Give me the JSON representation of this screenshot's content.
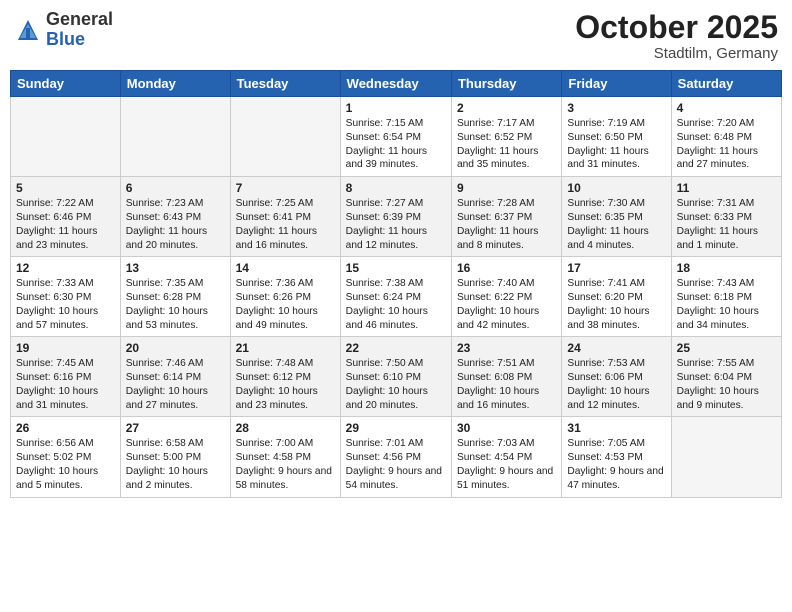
{
  "header": {
    "logo_general": "General",
    "logo_blue": "Blue",
    "month_year": "October 2025",
    "location": "Stadtilm, Germany"
  },
  "days_of_week": [
    "Sunday",
    "Monday",
    "Tuesday",
    "Wednesday",
    "Thursday",
    "Friday",
    "Saturday"
  ],
  "weeks": [
    [
      {
        "day": "",
        "info": ""
      },
      {
        "day": "",
        "info": ""
      },
      {
        "day": "",
        "info": ""
      },
      {
        "day": "1",
        "info": "Sunrise: 7:15 AM\nSunset: 6:54 PM\nDaylight: 11 hours and 39 minutes."
      },
      {
        "day": "2",
        "info": "Sunrise: 7:17 AM\nSunset: 6:52 PM\nDaylight: 11 hours and 35 minutes."
      },
      {
        "day": "3",
        "info": "Sunrise: 7:19 AM\nSunset: 6:50 PM\nDaylight: 11 hours and 31 minutes."
      },
      {
        "day": "4",
        "info": "Sunrise: 7:20 AM\nSunset: 6:48 PM\nDaylight: 11 hours and 27 minutes."
      }
    ],
    [
      {
        "day": "5",
        "info": "Sunrise: 7:22 AM\nSunset: 6:46 PM\nDaylight: 11 hours and 23 minutes."
      },
      {
        "day": "6",
        "info": "Sunrise: 7:23 AM\nSunset: 6:43 PM\nDaylight: 11 hours and 20 minutes."
      },
      {
        "day": "7",
        "info": "Sunrise: 7:25 AM\nSunset: 6:41 PM\nDaylight: 11 hours and 16 minutes."
      },
      {
        "day": "8",
        "info": "Sunrise: 7:27 AM\nSunset: 6:39 PM\nDaylight: 11 hours and 12 minutes."
      },
      {
        "day": "9",
        "info": "Sunrise: 7:28 AM\nSunset: 6:37 PM\nDaylight: 11 hours and 8 minutes."
      },
      {
        "day": "10",
        "info": "Sunrise: 7:30 AM\nSunset: 6:35 PM\nDaylight: 11 hours and 4 minutes."
      },
      {
        "day": "11",
        "info": "Sunrise: 7:31 AM\nSunset: 6:33 PM\nDaylight: 11 hours and 1 minute."
      }
    ],
    [
      {
        "day": "12",
        "info": "Sunrise: 7:33 AM\nSunset: 6:30 PM\nDaylight: 10 hours and 57 minutes."
      },
      {
        "day": "13",
        "info": "Sunrise: 7:35 AM\nSunset: 6:28 PM\nDaylight: 10 hours and 53 minutes."
      },
      {
        "day": "14",
        "info": "Sunrise: 7:36 AM\nSunset: 6:26 PM\nDaylight: 10 hours and 49 minutes."
      },
      {
        "day": "15",
        "info": "Sunrise: 7:38 AM\nSunset: 6:24 PM\nDaylight: 10 hours and 46 minutes."
      },
      {
        "day": "16",
        "info": "Sunrise: 7:40 AM\nSunset: 6:22 PM\nDaylight: 10 hours and 42 minutes."
      },
      {
        "day": "17",
        "info": "Sunrise: 7:41 AM\nSunset: 6:20 PM\nDaylight: 10 hours and 38 minutes."
      },
      {
        "day": "18",
        "info": "Sunrise: 7:43 AM\nSunset: 6:18 PM\nDaylight: 10 hours and 34 minutes."
      }
    ],
    [
      {
        "day": "19",
        "info": "Sunrise: 7:45 AM\nSunset: 6:16 PM\nDaylight: 10 hours and 31 minutes."
      },
      {
        "day": "20",
        "info": "Sunrise: 7:46 AM\nSunset: 6:14 PM\nDaylight: 10 hours and 27 minutes."
      },
      {
        "day": "21",
        "info": "Sunrise: 7:48 AM\nSunset: 6:12 PM\nDaylight: 10 hours and 23 minutes."
      },
      {
        "day": "22",
        "info": "Sunrise: 7:50 AM\nSunset: 6:10 PM\nDaylight: 10 hours and 20 minutes."
      },
      {
        "day": "23",
        "info": "Sunrise: 7:51 AM\nSunset: 6:08 PM\nDaylight: 10 hours and 16 minutes."
      },
      {
        "day": "24",
        "info": "Sunrise: 7:53 AM\nSunset: 6:06 PM\nDaylight: 10 hours and 12 minutes."
      },
      {
        "day": "25",
        "info": "Sunrise: 7:55 AM\nSunset: 6:04 PM\nDaylight: 10 hours and 9 minutes."
      }
    ],
    [
      {
        "day": "26",
        "info": "Sunrise: 6:56 AM\nSunset: 5:02 PM\nDaylight: 10 hours and 5 minutes."
      },
      {
        "day": "27",
        "info": "Sunrise: 6:58 AM\nSunset: 5:00 PM\nDaylight: 10 hours and 2 minutes."
      },
      {
        "day": "28",
        "info": "Sunrise: 7:00 AM\nSunset: 4:58 PM\nDaylight: 9 hours and 58 minutes."
      },
      {
        "day": "29",
        "info": "Sunrise: 7:01 AM\nSunset: 4:56 PM\nDaylight: 9 hours and 54 minutes."
      },
      {
        "day": "30",
        "info": "Sunrise: 7:03 AM\nSunset: 4:54 PM\nDaylight: 9 hours and 51 minutes."
      },
      {
        "day": "31",
        "info": "Sunrise: 7:05 AM\nSunset: 4:53 PM\nDaylight: 9 hours and 47 minutes."
      },
      {
        "day": "",
        "info": ""
      }
    ]
  ]
}
